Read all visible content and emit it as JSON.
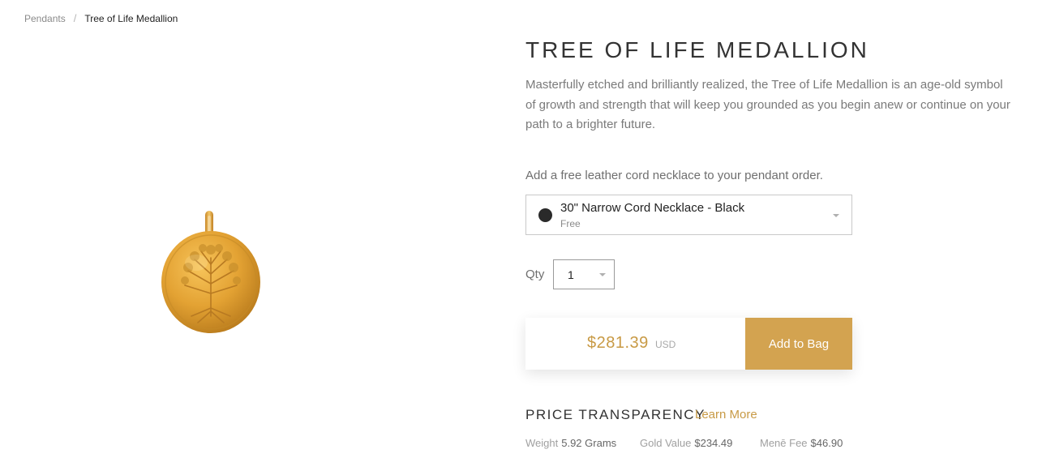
{
  "breadcrumb": {
    "parent": "Pendants",
    "separator": "/",
    "current": "Tree of Life Medallion"
  },
  "product": {
    "title": "TREE OF LIFE MEDALLION",
    "description": "Masterfully etched and brilliantly realized, the Tree of Life Medallion is an age-old symbol of growth and strength that will keep you grounded as you begin anew or continue on your path to a brighter future.",
    "image_icon": "gold-tree-of-life-medallion"
  },
  "cord": {
    "prompt": "Add a free leather cord necklace to your pendant order.",
    "selected_name": "30\" Narrow Cord Necklace - Black",
    "selected_price": "Free",
    "swatch_color": "#2a2a2a"
  },
  "quantity": {
    "label": "Qty",
    "value": "1"
  },
  "purchase": {
    "price": "$281.39",
    "currency": "USD",
    "button_label": "Add to Bag",
    "accent_color": "#d3a350"
  },
  "price_transparency": {
    "heading": "PRICE TRANSPARENCY",
    "learn_more": "Learn More",
    "weight_label": "Weight",
    "weight_value": "5.92 Grams",
    "gold_label": "Gold Value",
    "gold_value": "$234.49",
    "fee_label": "Menē Fee",
    "fee_value": "$46.90"
  }
}
